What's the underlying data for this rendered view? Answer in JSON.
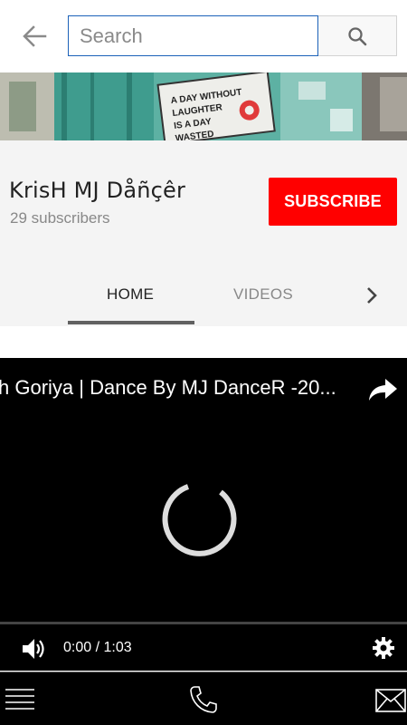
{
  "search": {
    "placeholder": "Search",
    "value": ""
  },
  "icons": {
    "back": "arrow-left-icon",
    "search": "magnifier-icon",
    "tab_next": "chevron-right-icon",
    "share": "share-arrow-icon",
    "volume": "speaker-icon",
    "settings": "gear-icon",
    "menu": "hamburger-icon",
    "phone": "phone-icon",
    "mail": "envelope-icon"
  },
  "banner": {
    "sign_text": "A DAY WITHOUT LAUGHTER IS A DAY WASTED"
  },
  "channel": {
    "name": "KrisH MJ Dåñçêr",
    "subscribers": "29 subscribers",
    "subscribe_label": "SUBSCRIBE"
  },
  "tabs": {
    "items": [
      {
        "label": "HOME",
        "active": true
      },
      {
        "label": "VIDEOS",
        "active": false
      }
    ]
  },
  "player": {
    "title": "h Goriya | Dance By MJ DanceR -20...",
    "time": "0:00 / 1:03",
    "progress": 0
  },
  "colors": {
    "accent": "#ff0000",
    "search_border": "#1c62b9",
    "player_bg": "#000000"
  }
}
